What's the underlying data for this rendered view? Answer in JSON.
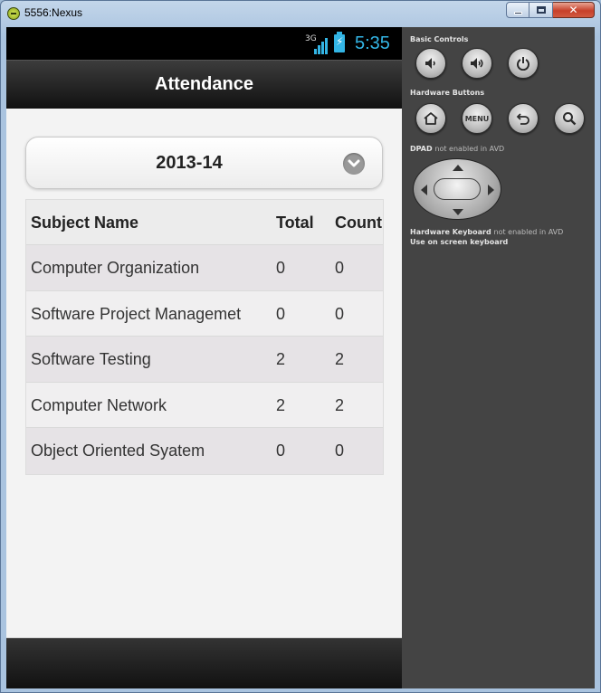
{
  "window": {
    "title": "5556:Nexus"
  },
  "status_bar": {
    "network": "3G",
    "time": "5:35"
  },
  "header": {
    "title": "Attendance"
  },
  "year_select": {
    "value": "2013-14"
  },
  "table": {
    "columns": [
      "Subject Name",
      "Total",
      "Count"
    ],
    "rows": [
      {
        "subject": "Computer Organization",
        "total": "0",
        "count": "0"
      },
      {
        "subject": "Software Project Managemet",
        "total": "0",
        "count": "0"
      },
      {
        "subject": "Software Testing",
        "total": "2",
        "count": "2"
      },
      {
        "subject": "Computer Network",
        "total": "2",
        "count": "2"
      },
      {
        "subject": "Object Oriented Syatem",
        "total": "0",
        "count": "0"
      }
    ]
  },
  "emulator_controls": {
    "basic_controls_label": "Basic Controls",
    "hardware_buttons_label": "Hardware Buttons",
    "menu_label": "MENU",
    "dpad_label": "DPAD",
    "dpad_note": "not enabled in AVD",
    "keyboard_label": "Hardware Keyboard",
    "keyboard_note": "not enabled in AVD",
    "keyboard_hint": "Use on screen keyboard",
    "icons": [
      "volume-down-icon",
      "volume-up-icon",
      "power-icon",
      "home-icon",
      "menu-button",
      "back-icon",
      "search-icon"
    ]
  },
  "colors": {
    "accent": "#33b5e5",
    "header_bg": "#1f1f1f",
    "content_bg": "#f3f3f3",
    "controls_bg": "#444444"
  }
}
